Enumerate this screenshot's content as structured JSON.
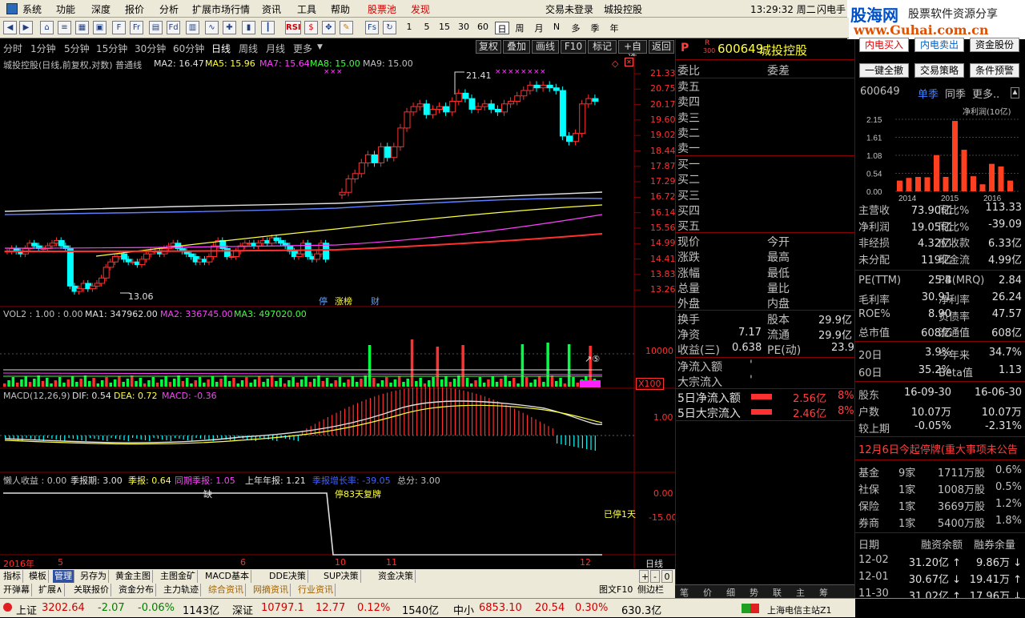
{
  "menu": {
    "items": [
      "系统",
      "功能",
      "深度",
      "报价",
      "分析",
      "扩展市场行情",
      "资讯",
      "工具",
      "帮助"
    ],
    "hot1": "股票池",
    "hot2": "发现",
    "login": "交易未登录",
    "stock_name": "城投控股",
    "clock": "13:29:32 周二",
    "flash": "闪电手"
  },
  "watermark": {
    "title": "股海网",
    "slogan": "股票软件资源分享",
    "url": "www.Guhai.com.cn"
  },
  "toolbar": {
    "nums": [
      "1",
      "5",
      "15",
      "30",
      "60"
    ],
    "periods": [
      "日",
      "周",
      "月",
      "N",
      "多",
      "季",
      "年"
    ]
  },
  "periodbar": {
    "items": [
      "分时",
      "1分钟",
      "5分钟",
      "15分钟",
      "30分钟",
      "60分钟",
      "日线",
      "周线",
      "月线",
      "更多"
    ],
    "active": "日线",
    "buttons": [
      "复权",
      "叠加",
      "画线",
      "F10",
      "标记",
      "+自选",
      "返回"
    ]
  },
  "chart_data": [
    {
      "type": "candlestick",
      "header": {
        "name": "城投控股(日线,前复权,对数) 普通线",
        "ma2": "MA2: 16.47",
        "ma5": "MA5: 15.96",
        "ma7": "MA7: 15.64",
        "ma8": "MA8: 15.00",
        "ma9": "MA9: 15.00"
      },
      "price_labels": [
        "21.33",
        "20.75",
        "20.17",
        "19.60",
        "19.02",
        "18.44",
        "17.87",
        "17.29",
        "16.72",
        "16.14",
        "15.56",
        "14.99",
        "14.41",
        "13.83",
        "13.26"
      ],
      "annotations": {
        "high": "21.41",
        "low": "13.06",
        "markers": [
          "停",
          "涨榜",
          "财"
        ]
      },
      "date_labels": [
        "2016年",
        "5",
        "6",
        "10",
        "11",
        "12"
      ]
    },
    {
      "type": "bar",
      "header": {
        "name": "VOL2 : 1.00 : 0.00",
        "ma1": "MA1: 347962.00",
        "ma2": "MA2: 336745.00",
        "ma3": "MA3: 497020.00"
      },
      "axis_label": "10000",
      "unit": "X100",
      "marker": "↗⑤"
    },
    {
      "type": "line",
      "header": {
        "name": "MACD(12,26,9)",
        "dif": "DIF: 0.54",
        "dea": "DEA: 0.72",
        "macd": "MACD: -0.36"
      },
      "axis_label": "1.00"
    },
    {
      "type": "line",
      "header": {
        "a": "懒人收益 : 0.00",
        "b": "季报期: 3.00",
        "c": "季报: 0.64",
        "d": "同期季报: 1.05",
        "e": "上年年报: 1.21",
        "f": "季报增长率: -39.05",
        "g": "总分: 3.00"
      },
      "labels": {
        "missing": "缺",
        "halt": "停83天复牌",
        "halted": "已停1天"
      },
      "axis": [
        "0.00",
        "-15.00"
      ],
      "period_label": "日线"
    }
  ],
  "quote": {
    "code": "600649",
    "name": "城投控股",
    "top_labels": [
      "委比",
      "委差"
    ],
    "sells": [
      "卖五",
      "卖四",
      "卖三",
      "卖二",
      "卖一"
    ],
    "buys": [
      "买一",
      "买二",
      "买三",
      "买四",
      "买五"
    ],
    "stats_left": [
      "现价",
      "涨跌",
      "涨幅",
      "总量",
      "外盘"
    ],
    "stats_right": [
      "今开",
      "最高",
      "最低",
      "量比",
      "内盘"
    ],
    "turnover": "换手",
    "share_cap": "股本",
    "share_cap_val": "29.9亿",
    "net_asset": "净资",
    "net_asset_val": "7.17",
    "float": "流通",
    "float_val": "29.9亿",
    "eps": "收益(三)",
    "eps_val": "0.638",
    "pe": "PE(动)",
    "pe_val": "23.9",
    "netflow": "净流入额",
    "block": "大宗流入",
    "d5_net": "5日净流入额",
    "d5_net_val": "2.56亿",
    "d5_net_pct": "8%",
    "d5_block": "5日大宗流入",
    "d5_block_val": "2.46亿",
    "d5_block_pct": "8%"
  },
  "fin": {
    "buttons": [
      "内电买入",
      "内电卖出",
      "资金股份",
      "一键全撤",
      "交易策略",
      "条件预警"
    ],
    "code": "600649",
    "tabs": [
      "单季",
      "同季",
      "更多.."
    ],
    "chart_title": "净利润(10亿)",
    "chart_data": {
      "type": "bar",
      "y_ticks": [
        "2.15",
        "1.61",
        "1.08",
        "0.54",
        "0.00"
      ],
      "x_ticks": [
        "2014",
        "2015",
        "2016"
      ],
      "values": [
        0.32,
        0.4,
        0.43,
        0.42,
        1.08,
        0.43,
        2.1,
        1.24,
        0.45,
        0.21,
        0.82,
        0.74,
        0.32
      ]
    },
    "rows": [
      [
        "主营收",
        "73.90亿",
        "同比%",
        "113.33"
      ],
      [
        "净利润",
        "19.05亿",
        "同比%",
        "-39.09"
      ],
      [
        "非经损",
        "4.32亿",
        "应收款",
        "6.33亿"
      ],
      [
        "未分配",
        "119亿",
        "现金流",
        "4.99亿"
      ],
      [
        "PE(TTM)",
        "25.4",
        "PB(MRQ)",
        "2.84"
      ],
      [
        "毛利率",
        "30.91",
        "净利率",
        "26.24"
      ],
      [
        "ROE%",
        "8.90",
        "负债率",
        "47.57"
      ],
      [
        "总市值",
        "608亿",
        "流通值",
        "608亿"
      ],
      [
        "20日",
        "3.9%",
        "今年来",
        "34.7%"
      ],
      [
        "60日",
        "35.2%",
        "Beta值",
        "1.13"
      ],
      [
        "股东",
        "16-09-30",
        "",
        "16-06-30"
      ],
      [
        "户数",
        "10.07万",
        "",
        "10.07万"
      ],
      [
        "较上期",
        "-0.05%",
        "",
        "-2.31%"
      ]
    ],
    "notice": "12月6日今起停牌(重大事项未公告",
    "inst": [
      [
        "基金",
        "9家",
        "1711万股",
        "0.6%"
      ],
      [
        "社保",
        "1家",
        "1008万股",
        "0.5%"
      ],
      [
        "保险",
        "1家",
        "3669万股",
        "1.2%"
      ],
      [
        "券商",
        "1家",
        "5400万股",
        "1.8%"
      ]
    ],
    "margin_head": [
      "日期",
      "融资余额",
      "融券余量"
    ],
    "margin": [
      [
        "12-02",
        "31.20亿 ↑",
        "9.86万 ↓"
      ],
      [
        "12-01",
        "30.67亿 ↓",
        "19.41万 ↑"
      ],
      [
        "11-30",
        "31.02亿 ↑",
        "17.96万 ↓"
      ]
    ]
  },
  "tabs": {
    "row1": [
      "指标",
      "模板",
      "管理",
      "另存为",
      "黄金主图",
      "主图金矿",
      "MACD基本",
      "DDE决策",
      "SUP决策",
      "资金决策"
    ],
    "row2": [
      "开弹幕",
      "扩展∧",
      "关联报价",
      "资金分布",
      "主力轨迹",
      "综合资讯",
      "网摘资讯",
      "行业资讯"
    ],
    "right": [
      "图文F10",
      "侧边栏"
    ],
    "controls": [
      "+",
      "-",
      "0"
    ],
    "bottom_right": [
      "笔",
      "价",
      "细",
      "势",
      "联",
      "主",
      "筹"
    ]
  },
  "status": {
    "sh": "上证",
    "sh_val": "3202.64",
    "sh_chg": "-2.07",
    "sh_pct": "-0.06%",
    "sh_amt": "1143亿",
    "sz": "深证",
    "sz_val": "10797.1",
    "sz_chg": "12.77",
    "sz_pct": "0.12%",
    "sz_amt": "1540亿",
    "zx": "中小",
    "zx_val": "6853.10",
    "zx_chg": "20.54",
    "zx_pct": "0.30%",
    "zx_amt": "630.3亿",
    "server": "上海电信主站Z1"
  }
}
